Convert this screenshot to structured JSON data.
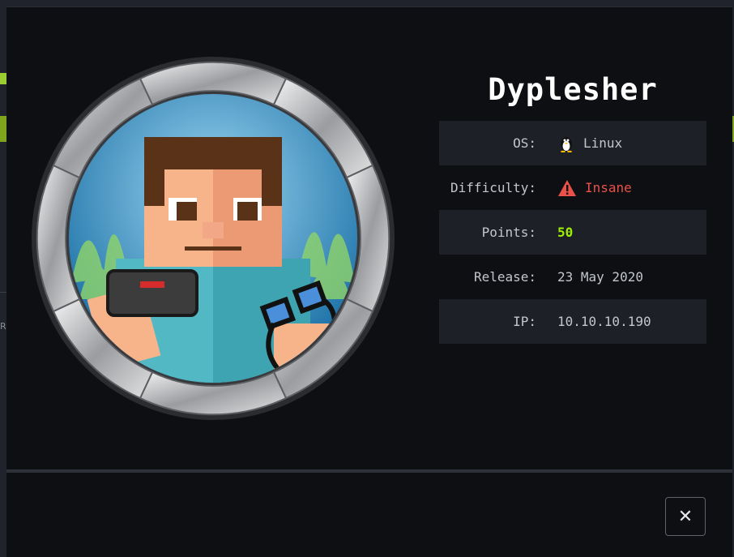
{
  "backdrop": {
    "edge_letter": "R"
  },
  "machine": {
    "name": "Dyplesher",
    "rows": [
      {
        "label": "OS:",
        "value": "Linux",
        "icon": "linux-penguin-icon"
      },
      {
        "label": "Difficulty:",
        "value": "Insane",
        "icon": "warning-triangle-icon",
        "color": "#ea5148"
      },
      {
        "label": "Points:",
        "value": "50",
        "color": "#9fef00"
      },
      {
        "label": "Release:",
        "value": "23 May 2020"
      },
      {
        "label": "IP:",
        "value": "10.10.10.190"
      }
    ]
  },
  "close_button": {
    "label": "✕"
  }
}
